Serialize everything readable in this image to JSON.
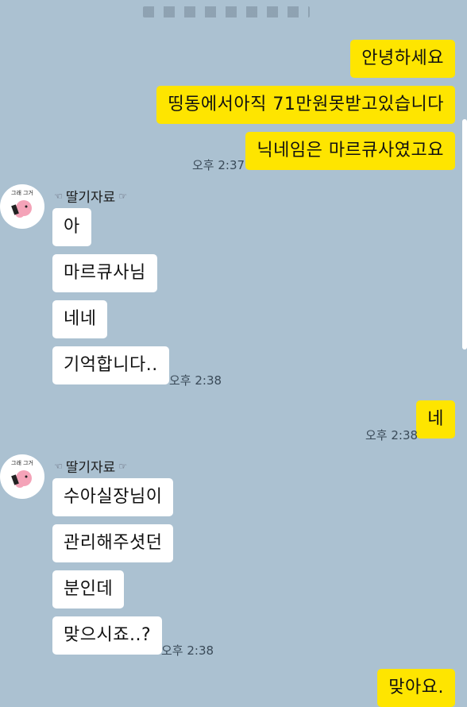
{
  "chat": {
    "messages_me_1": "안녕하세요",
    "messages_me_2": "띵동에서아직 71만원못받고있습니다",
    "messages_me_3": "닉네임은 마르큐사였고요",
    "time_1": "오후 2:37",
    "sender_1": "딸기자료",
    "other_1": "아",
    "other_2": "마르큐사님",
    "other_3": "네네",
    "other_4": "기억합니다..",
    "time_2": "오후 2:38",
    "me_4": "네",
    "time_3": "오후 2:38",
    "sender_2": "딸기자료",
    "other_5": "수아실장님이",
    "other_6": "관리해주셧던",
    "other_7": "분인데",
    "other_8": "맞으시죠..?",
    "time_4": "오후 2:38",
    "me_5": "맞아요.",
    "avatar_caption": "그래 그거"
  },
  "colors": {
    "background": "#abc1d1",
    "my_bubble": "#fee500",
    "other_bubble": "#ffffff"
  },
  "icons": [
    "avatar-icon",
    "pointing-hand-icon"
  ]
}
